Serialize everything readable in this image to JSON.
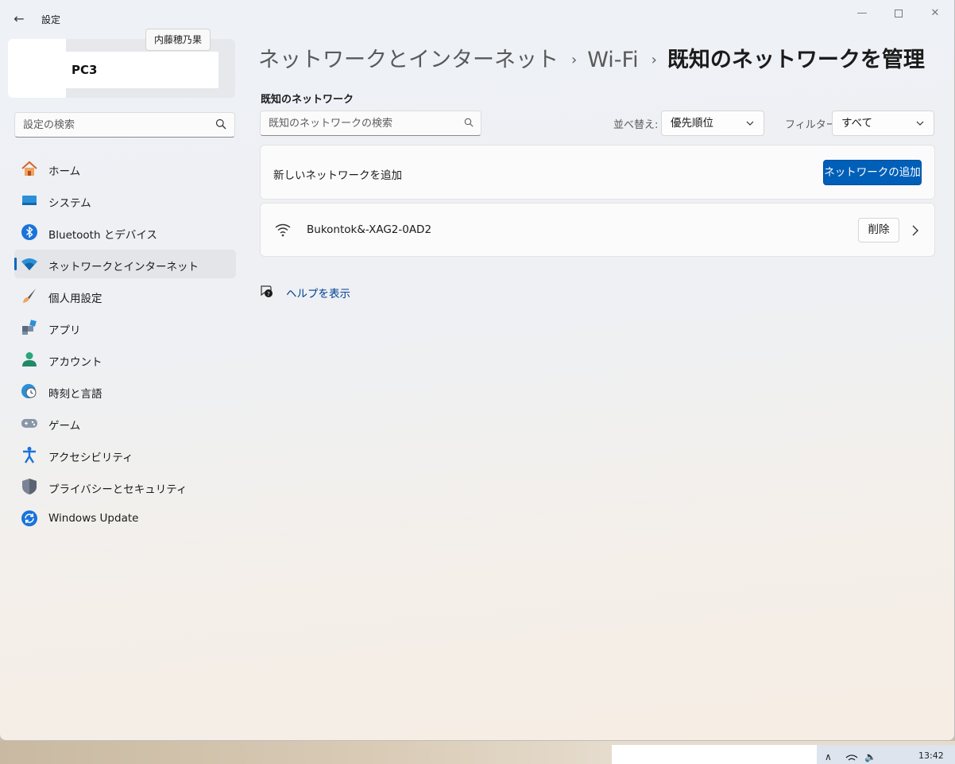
{
  "window": {
    "title": "設定",
    "back_glyph": "←",
    "minimize_glyph": "—",
    "close_glyph": "✕"
  },
  "profile": {
    "name": "PC3",
    "tooltip": "内藤穂乃果"
  },
  "sidebar": {
    "search_placeholder": "設定の検索",
    "items": [
      {
        "label": "ホーム",
        "icon": "home-icon"
      },
      {
        "label": "システム",
        "icon": "system-icon"
      },
      {
        "label": "Bluetooth とデバイス",
        "icon": "bluetooth-icon"
      },
      {
        "label": "ネットワークとインターネット",
        "icon": "wifi-icon",
        "active": true
      },
      {
        "label": "個人用設定",
        "icon": "brush-icon"
      },
      {
        "label": "アプリ",
        "icon": "apps-icon"
      },
      {
        "label": "アカウント",
        "icon": "account-icon"
      },
      {
        "label": "時刻と言語",
        "icon": "clock-globe-icon"
      },
      {
        "label": "ゲーム",
        "icon": "gamepad-icon"
      },
      {
        "label": "アクセシビリティ",
        "icon": "accessibility-icon"
      },
      {
        "label": "プライバシーとセキュリティ",
        "icon": "shield-icon"
      },
      {
        "label": "Windows Update",
        "icon": "update-icon"
      }
    ]
  },
  "breadcrumb": {
    "level1": "ネットワークとインターネット",
    "level2": "Wi-Fi",
    "current": "既知のネットワークを管理",
    "separator": "›"
  },
  "main": {
    "section_title": "既知のネットワーク",
    "search_placeholder": "既知のネットワークの検索",
    "sort_label": "並べ替え:",
    "sort_value": "優先順位",
    "filter_label": "フィルター:",
    "filter_value": "すべて",
    "add_network_text": "新しいネットワークを追加",
    "add_network_button": "ネットワークの追加",
    "networks": [
      {
        "name": "Bukontok&-XAG2-0AD2",
        "delete_label": "削除"
      }
    ],
    "help_link": "ヘルプを表示"
  },
  "taskbar": {
    "time": "13:42",
    "chevron_glyph": "∧",
    "speaker_glyph": "🔈"
  },
  "colors": {
    "accent": "#005fb8",
    "active_indicator": "#0067c0",
    "link": "#003e92"
  }
}
